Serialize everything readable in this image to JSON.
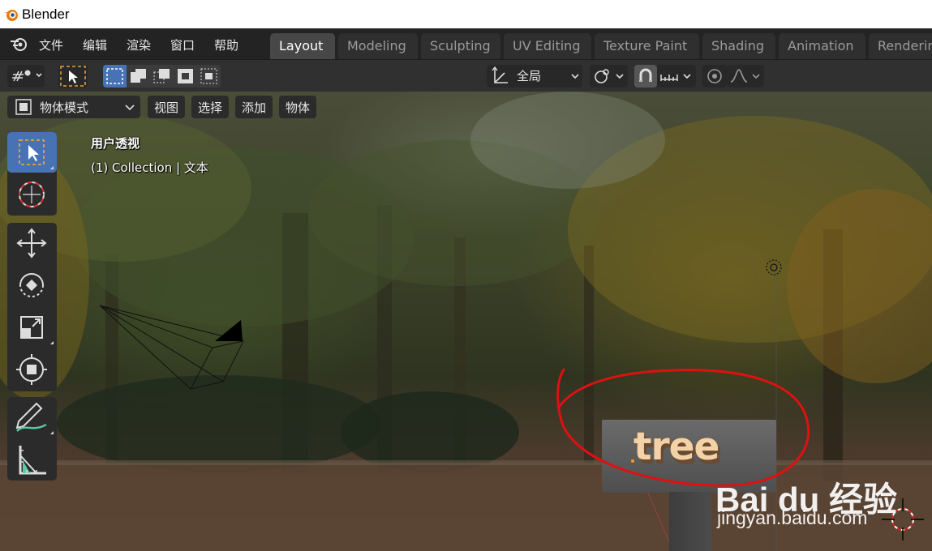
{
  "window": {
    "title": "Blender"
  },
  "menus": [
    "文件",
    "编辑",
    "渲染",
    "窗口",
    "帮助"
  ],
  "workspace_tabs": [
    {
      "label": "Layout",
      "active": true
    },
    {
      "label": "Modeling",
      "active": false
    },
    {
      "label": "Sculpting",
      "active": false
    },
    {
      "label": "UV Editing",
      "active": false
    },
    {
      "label": "Texture Paint",
      "active": false
    },
    {
      "label": "Shading",
      "active": false
    },
    {
      "label": "Animation",
      "active": false
    },
    {
      "label": "Renderin",
      "active": false
    }
  ],
  "header": {
    "transform_orientation": "全局"
  },
  "viewport": {
    "mode": "物体模式",
    "menus": [
      "视图",
      "选择",
      "添加",
      "物体"
    ],
    "view_label": "用户透视",
    "collection_label": "(1) Collection | 文本",
    "sign_text": "tree"
  },
  "toolbar": {
    "tools": [
      {
        "icon": "select-box-icon",
        "active": true
      },
      {
        "icon": "cursor-icon",
        "active": false
      },
      {
        "icon": "move-icon",
        "active": false
      },
      {
        "icon": "rotate-icon",
        "active": false
      },
      {
        "icon": "scale-icon",
        "active": false
      },
      {
        "icon": "transform-icon",
        "active": false
      },
      {
        "icon": "annotate-icon",
        "active": false
      },
      {
        "icon": "measure-icon",
        "active": false
      }
    ]
  },
  "watermark": {
    "brand": "Bai du 经验",
    "url": "jingyan.baidu.com"
  },
  "colors": {
    "accent": "#4772b3",
    "active_tab": "#474747",
    "annotation": "#e01010"
  }
}
